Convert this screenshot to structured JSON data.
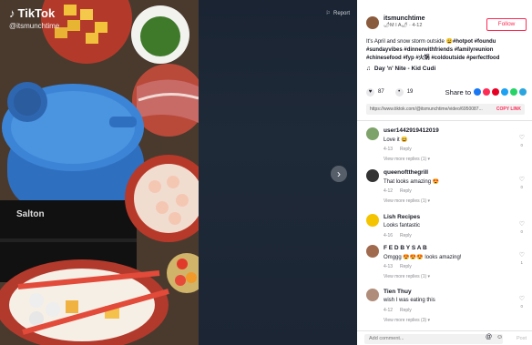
{
  "video": {
    "app_name": "TikTok",
    "handle_overlay": "@itsmunchtime",
    "report_label": "Report",
    "stove_brand": "Salton"
  },
  "author": {
    "username": "itsmunchtime",
    "meta": "🌶M I A🌶 · 4-12",
    "follow_label": "Follow"
  },
  "caption": {
    "text": "It's April and snow storm outside 😩",
    "hashtags": "#hotpot #foundu #sundayvibes #dinnerwithfriends #familyreunion #chinesefood #fyp #火锅 #coldoutside #perfectfood"
  },
  "music": {
    "title": "Day 'n' Nite - Kid Cudi"
  },
  "actions": {
    "likes": "87",
    "comments": "19",
    "share_label": "Share to"
  },
  "share_colors": [
    "#1877f2",
    "#fe2c55",
    "#e60023",
    "#1da1f2",
    "#25d366",
    "#2aa5dd"
  ],
  "link": {
    "url": "https://www.tiktok.com/@itsmunchtime/video/6950087...",
    "copy_label": "COPY LINK"
  },
  "comments": [
    {
      "user": "user1442919412019",
      "text": "Love it 😆",
      "date": "4-13",
      "reply": "Reply",
      "likes": "0",
      "view_more": "View more replies (1) ▾",
      "avatar_color": "#7ea36a"
    },
    {
      "user": "queenoftthegrill",
      "text": "That looks amazing 😍",
      "date": "4-12",
      "reply": "Reply",
      "likes": "0",
      "view_more": "View more replies (1) ▾",
      "avatar_color": "#333333"
    },
    {
      "user": "Lish Recipes",
      "text": "Looks fantastic",
      "date": "4-16",
      "reply": "Reply",
      "likes": "0",
      "view_more": "",
      "avatar_color": "#f5c400"
    },
    {
      "user": "F E D B Y S A B",
      "text": "Omggg 😍😍😍 looks amazing!",
      "date": "4-13",
      "reply": "Reply",
      "likes": "1",
      "view_more": "View more replies (1) ▾",
      "avatar_color": "#a06a4e"
    },
    {
      "user": "Tien Thuy",
      "text": "wish I was eating this",
      "date": "4-12",
      "reply": "Reply",
      "likes": "0",
      "view_more": "View more replies (3) ▾",
      "avatar_color": "#b08d7a"
    }
  ],
  "comment_bar": {
    "placeholder": "Add comment...",
    "post_label": "Post"
  }
}
